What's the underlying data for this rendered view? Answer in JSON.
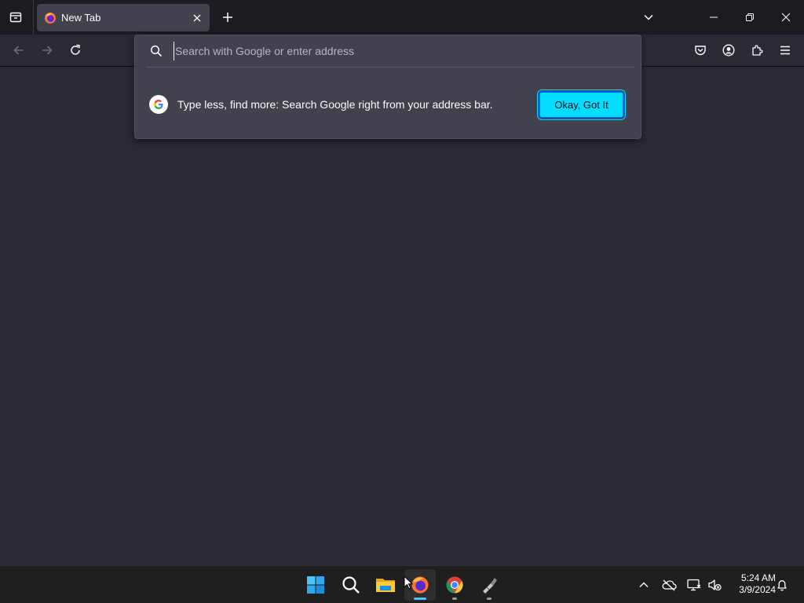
{
  "browser": {
    "tab": {
      "title": "New Tab",
      "favicon": "firefox-icon"
    },
    "icons": {
      "tab_list": "tab-list-icon",
      "tab_close": "close-icon",
      "new_tab": "plus-icon",
      "tab_overflow": "chevron-down-icon",
      "minimize": "minimize-icon",
      "restore": "restore-icon",
      "close": "close-icon",
      "back": "back-arrow-icon",
      "forward": "forward-arrow-icon",
      "reload": "reload-icon",
      "pocket": "pocket-icon",
      "account": "account-icon",
      "extensions": "extensions-icon",
      "menu": "hamburger-menu-icon"
    }
  },
  "urlbar": {
    "placeholder": "Search with Google or enter address",
    "value": "",
    "tip": {
      "text": "Type less, find more: Search Google right from your address bar.",
      "button_label": "Okay, Got It"
    }
  },
  "taskbar": {
    "apps": [
      "windows-start-icon",
      "search-icon",
      "file-explorer-icon",
      "firefox-icon",
      "chrome-icon",
      "tool-app-icon"
    ],
    "tray": [
      "chevron-up-icon",
      "onedrive-offline-icon",
      "network-icon",
      "volume-muted-icon",
      "notification-bell-icon"
    ],
    "clock": {
      "time": "5:24 AM",
      "date": "3/9/2024"
    }
  },
  "colors": {
    "frame": "#1c1b22",
    "toolbar": "#2b2a33",
    "popup": "#42414d",
    "accent": "#00ddff",
    "taskbar": "#1f1f1f"
  }
}
